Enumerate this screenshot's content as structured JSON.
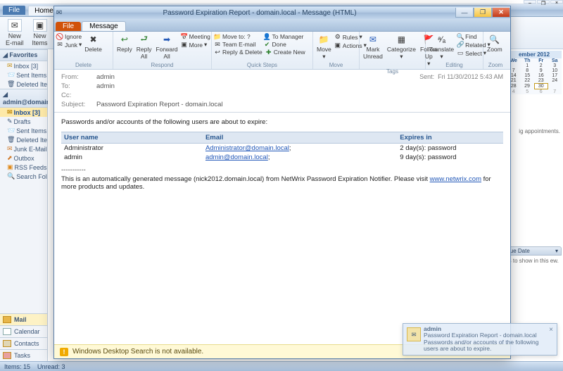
{
  "outer": {
    "tabs": {
      "file": "File",
      "home": "Home"
    },
    "new": {
      "email": "New\nE-mail",
      "items": "New\nItems"
    },
    "favorites_hdr": "Favorites",
    "favorites": [
      {
        "label": "Inbox [3]"
      },
      {
        "label": "Sent Items"
      },
      {
        "label": "Deleted Ite"
      }
    ],
    "account_hdr": "admin@domain.l",
    "account_items": [
      {
        "label": "Inbox [3]",
        "sel": true
      },
      {
        "label": "Drafts"
      },
      {
        "label": "Sent Items"
      },
      {
        "label": "Deleted Ite"
      },
      {
        "label": "Junk E-Mail"
      },
      {
        "label": "Outbox"
      },
      {
        "label": "RSS Feeds"
      },
      {
        "label": "Search Fold"
      }
    ],
    "nav": {
      "mail": "Mail",
      "calendar": "Calendar",
      "contacts": "Contacts",
      "tasks": "Tasks"
    },
    "status": {
      "items": "Items: 15",
      "unread": "Unread: 3"
    }
  },
  "calendar": {
    "month": "ember 2012",
    "dow": [
      "We",
      "Th",
      "Fr",
      "Sa"
    ],
    "weeks": [
      [
        "",
        "1",
        "2",
        "3"
      ],
      [
        "7",
        "8",
        "9",
        "10"
      ],
      [
        "14",
        "15",
        "16",
        "17"
      ],
      [
        "21",
        "22",
        "23",
        "24"
      ],
      [
        "28",
        "29",
        "30",
        ""
      ],
      [
        "4",
        "5",
        "6",
        "7"
      ]
    ],
    "today": "30",
    "appt_msg": "ig appointments.",
    "todo_hdr": "Due Date",
    "todo_msg": "ms to show in this ew."
  },
  "msg": {
    "title": "Password Expiration Report - domain.local - Message (HTML)",
    "tabs": {
      "file": "File",
      "message": "Message"
    },
    "ribbon": {
      "delete_grp": {
        "ignore": "Ignore",
        "junk": "Junk",
        "delete": "Delete",
        "label": "Delete"
      },
      "respond_grp": {
        "reply": "Reply",
        "replyall": "Reply\nAll",
        "forward": "Forward\nAll",
        "meeting": "Meeting",
        "more": "More",
        "label": "Respond"
      },
      "quick_grp": {
        "moveto": "Move to: ?",
        "manager": "To Manager",
        "team": "Team E-mail",
        "done": "Done",
        "replydel": "Reply & Delete",
        "create": "Create New",
        "label": "Quick Steps"
      },
      "move_grp": {
        "move": "Move",
        "rules": "Rules",
        "actions": "Actions",
        "label": "Move"
      },
      "tags_grp": {
        "unread": "Mark\nUnread",
        "cat": "Categorize",
        "follow": "Follow\nUp",
        "label": "Tags"
      },
      "edit_grp": {
        "translate": "Translate",
        "find": "Find",
        "related": "Related",
        "select": "Select",
        "label": "Editing"
      },
      "zoom_grp": {
        "zoom": "Zoom",
        "label": "Zoom"
      }
    },
    "headers": {
      "from_lbl": "From:",
      "from": "admin",
      "to_lbl": "To:",
      "to": "admin",
      "cc_lbl": "Cc:",
      "subject_lbl": "Subject:",
      "subject": "Password Expiration Report - domain.local",
      "sent_lbl": "Sent:",
      "sent": "Fri 11/30/2012 5:43 AM"
    },
    "body": {
      "intro": "Passwords and/or accounts of the following users are about to expire:",
      "cols": {
        "user": "User name",
        "email": "Email",
        "expires": "Expires in"
      },
      "rows": [
        {
          "user": "Administrator",
          "email": "Administrator@domain.local",
          "expires": "2 day(s): password"
        },
        {
          "user": "admin",
          "email": "admin@domain.local",
          "expires": "9 day(s): password"
        }
      ],
      "sep": "-----------",
      "auto_pre": "This is an automatically generated message (nick2012.domain.local) from NetWrix Password Expiration Notifier. Please visit ",
      "auto_link": "www.netwrix.com",
      "auto_post": " for more products and updates."
    },
    "warning": "Windows Desktop Search is not available."
  },
  "toast": {
    "name": "admin",
    "subj": "Password Expiration Report - domain.local",
    "body": "Passwords and/or accounts of the following users are about to expire."
  }
}
